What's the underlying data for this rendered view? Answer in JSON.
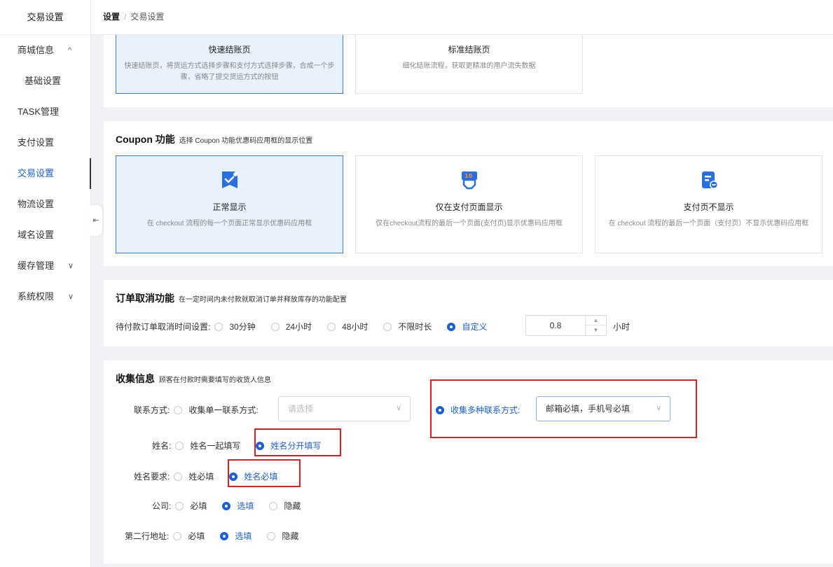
{
  "sidebar": {
    "title": "交易设置",
    "items": [
      {
        "label": "商城信息",
        "chevron": "^"
      },
      {
        "label": "基础设置"
      },
      {
        "label": "TASK管理"
      },
      {
        "label": "支付设置"
      },
      {
        "label": "交易设置"
      },
      {
        "label": "物流设置"
      },
      {
        "label": "域名设置"
      },
      {
        "label": "缓存管理",
        "chevron": "∨"
      },
      {
        "label": "系统权限",
        "chevron": "∨"
      }
    ],
    "collapse_glyph": "⇤"
  },
  "breadcrumb": {
    "root": "设置",
    "sep": "/",
    "current": "交易设置"
  },
  "checkout": {
    "cards": [
      {
        "title": "快速结账页",
        "desc": "快速结账页，将货运方式选择步骤和支付方式选择步骤，合成一个步骤，省略了提交货运方式的按钮"
      },
      {
        "title": "标准结账页",
        "desc": "细化结账流程，获取更精准的用户流失数据"
      }
    ]
  },
  "coupon": {
    "title": "Coupon 功能",
    "subtitle": "选择 Coupon 功能优惠码应用框的显示位置",
    "cards": [
      {
        "title": "正常显示",
        "desc": "在 checkout 流程的每一个页面正常显示优惠码应用框",
        "icon": "ticket-check-icon"
      },
      {
        "title": "仅在支付页面显示",
        "desc": "仅在checkout流程的最后一个页面(支付页)显示优惠码应用框",
        "icon": "coupon-register-icon"
      },
      {
        "title": "支付页不显示",
        "desc": "在 checkout 流程的最后一个页面（支付页）不显示优惠码应用框",
        "icon": "document-minus-icon"
      }
    ]
  },
  "cancel": {
    "title": "订单取消功能",
    "subtitle": "在一定时间内未付款就取消订单并释放库存的功能配置",
    "row_label": "待付款订单取消时间设置:",
    "options": [
      "30分钟",
      "24小时",
      "48小时",
      "不限时长",
      "自定义"
    ],
    "value": "0.8",
    "unit": "小时"
  },
  "collect": {
    "title": "收集信息",
    "subtitle": "顾客在付款时需要填写的收货人信息",
    "contact": {
      "label": "联系方式:",
      "option_single": "收集单一联系方式:",
      "single_placeholder": "请选择",
      "option_multi": "收集多种联系方式:",
      "multi_value": "邮箱必填，手机号必填"
    },
    "name": {
      "label": "姓名:",
      "options": [
        "姓名一起填写",
        "姓名分开填写"
      ]
    },
    "name_req": {
      "label": "姓名要求:",
      "options": [
        "姓必填",
        "姓名必填"
      ]
    },
    "company": {
      "label": "公司:",
      "options": [
        "必填",
        "选填",
        "隐藏"
      ]
    },
    "address2": {
      "label": "第二行地址:",
      "options": [
        "必填",
        "选填",
        "隐藏"
      ]
    }
  },
  "colors": {
    "accent": "#1a5fd6",
    "highlight": "#e02020"
  }
}
